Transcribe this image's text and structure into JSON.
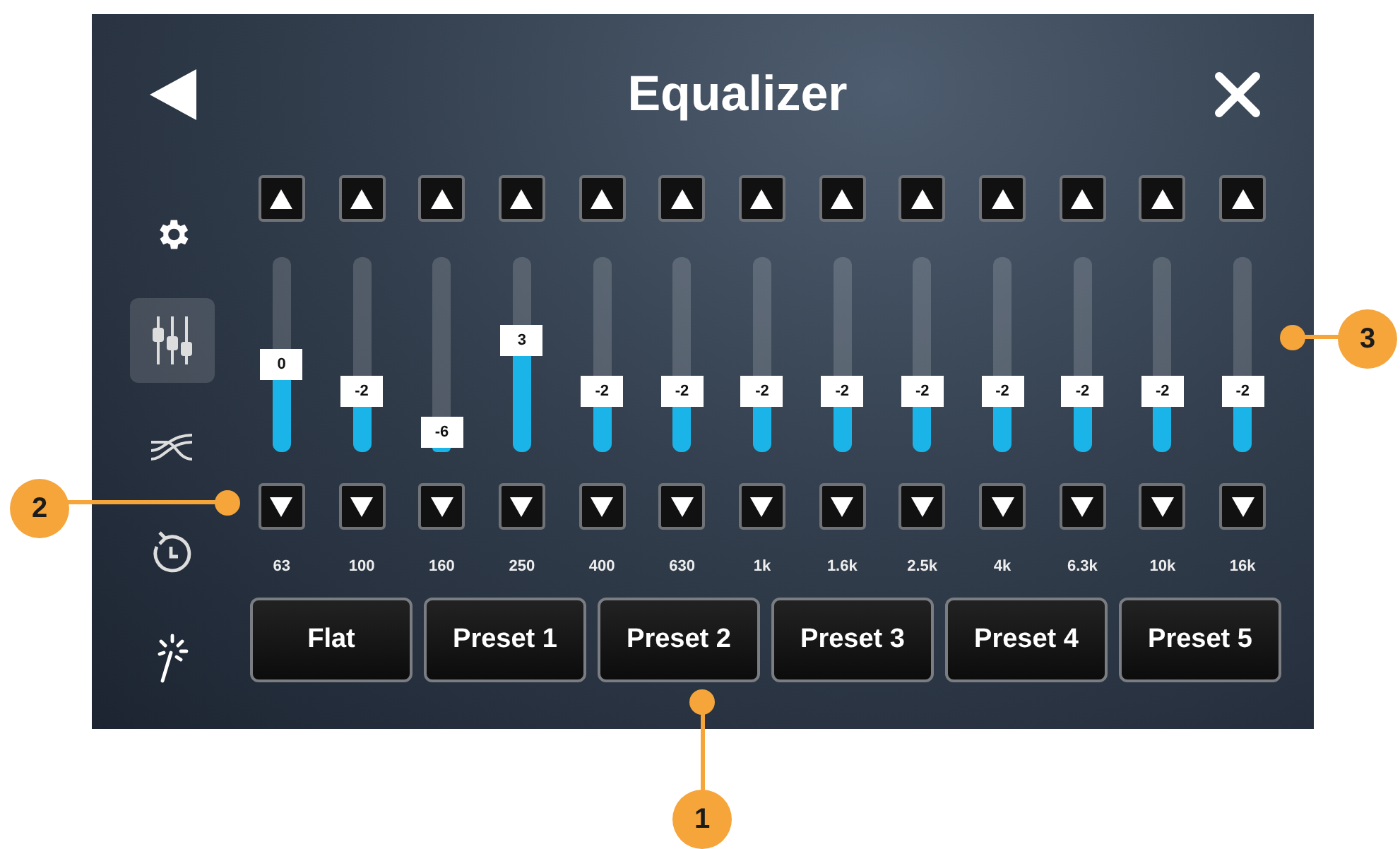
{
  "header": {
    "title": "Equalizer"
  },
  "sidebar": {
    "items": [
      {
        "kind": "settings",
        "selected": false
      },
      {
        "kind": "equalizer",
        "selected": true
      },
      {
        "kind": "crossover",
        "selected": false
      },
      {
        "kind": "timer",
        "selected": false
      },
      {
        "kind": "magic",
        "selected": false
      }
    ]
  },
  "bands": [
    {
      "frequency": "63",
      "value": "0",
      "level": 0.45
    },
    {
      "frequency": "100",
      "value": "-2",
      "level": 0.31
    },
    {
      "frequency": "160",
      "value": "-6",
      "level": 0.1
    },
    {
      "frequency": "250",
      "value": "3",
      "level": 0.57
    },
    {
      "frequency": "400",
      "value": "-2",
      "level": 0.31
    },
    {
      "frequency": "630",
      "value": "-2",
      "level": 0.31
    },
    {
      "frequency": "1k",
      "value": "-2",
      "level": 0.31
    },
    {
      "frequency": "1.6k",
      "value": "-2",
      "level": 0.31
    },
    {
      "frequency": "2.5k",
      "value": "-2",
      "level": 0.31
    },
    {
      "frequency": "4k",
      "value": "-2",
      "level": 0.31
    },
    {
      "frequency": "6.3k",
      "value": "-2",
      "level": 0.31
    },
    {
      "frequency": "10k",
      "value": "-2",
      "level": 0.31
    },
    {
      "frequency": "16k",
      "value": "-2",
      "level": 0.31
    }
  ],
  "presets": [
    {
      "label": "Flat"
    },
    {
      "label": "Preset 1"
    },
    {
      "label": "Preset 2"
    },
    {
      "label": "Preset 3"
    },
    {
      "label": "Preset 4"
    },
    {
      "label": "Preset 5"
    }
  ],
  "callouts": [
    {
      "number": "1"
    },
    {
      "number": "2"
    },
    {
      "number": "3"
    }
  ]
}
